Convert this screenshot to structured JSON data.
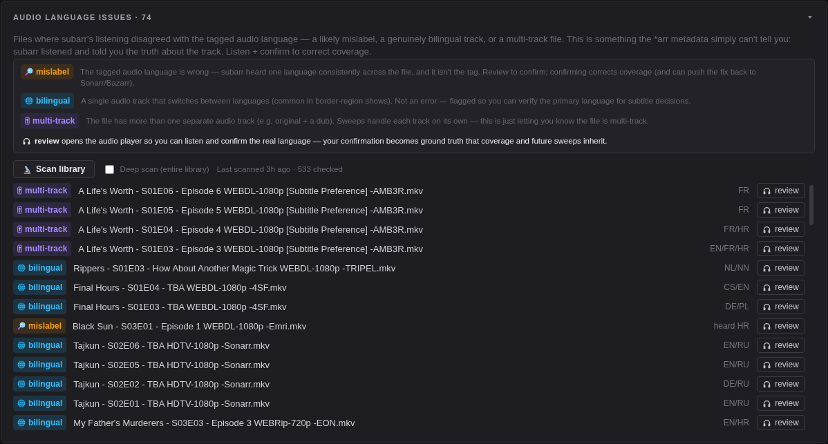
{
  "panel": {
    "title": "AUDIO LANGUAGE ISSUES · 74",
    "description": "Files where subarr's listening disagreed with the tagged audio language — a likely mislabel, a genuinely bilingual track, or a multi-track file. This is something the *arr metadata simply can't tell you: subarr listened and told you the truth about the track. Listen + confirm to correct coverage."
  },
  "legend": {
    "items": [
      {
        "kind": "mislabel",
        "tag": "mislabel",
        "text": "The tagged audio language is wrong — subarr heard one language consistently across the file, and it isn't the tag. Review to confirm; confirming corrects coverage (and can push the fix back to Sonarr/Bazarr)."
      },
      {
        "kind": "bilingual",
        "tag": "bilingual",
        "text": "A single audio track that switches between languages (common in border-region shows). Not an error — flagged so you can verify the primary language for subtitle decisions."
      },
      {
        "kind": "multitrack",
        "tag": "multi-track",
        "text": "The file has more than one separate audio track (e.g. original + a dub). Sweeps handle each track on its own — this is just letting you know the file is multi-track."
      }
    ],
    "note": "**review** opens the audio player so you can listen and confirm the real language — your confirmation becomes ground truth that coverage and future sweeps inherit."
  },
  "toolbar": {
    "scan_button": "Scan library",
    "deep_scan": {
      "label": "Deep scan (entire library)",
      "checked": false
    },
    "status": "Last scanned 3h ago · 533 checked"
  },
  "rows": [
    {
      "kind": "multitrack",
      "tag": "multi-track",
      "file": "A Life's Worth - S01E06 - Episode 6 WEBDL-1080p [Subtitle Preference] -AMB3R.mkv",
      "languages": "FR",
      "action": "review"
    },
    {
      "kind": "multitrack",
      "tag": "multi-track",
      "file": "A Life's Worth - S01E05 - Episode 5 WEBDL-1080p [Subtitle Preference] -AMB3R.mkv",
      "languages": "FR",
      "action": "review"
    },
    {
      "kind": "multitrack",
      "tag": "multi-track",
      "file": "A Life's Worth - S01E04 - Episode 4 WEBDL-1080p [Subtitle Preference] -AMB3R.mkv",
      "languages": "FR/HR",
      "action": "review"
    },
    {
      "kind": "multitrack",
      "tag": "multi-track",
      "file": "A Life's Worth - S01E03 - Episode 3 WEBDL-1080p [Subtitle Preference] -AMB3R.mkv",
      "languages": "EN/FR/HR",
      "action": "review"
    },
    {
      "kind": "bilingual",
      "tag": "bilingual",
      "file": "Rippers - S01E03 - How About Another Magic Trick WEBDL-1080p -TRIPEL.mkv",
      "languages": "NL/NN",
      "action": "review"
    },
    {
      "kind": "bilingual",
      "tag": "bilingual",
      "file": "Final Hours - S01E04 - TBA WEBDL-1080p -4SF.mkv",
      "languages": "CS/EN",
      "action": "review"
    },
    {
      "kind": "bilingual",
      "tag": "bilingual",
      "file": "Final Hours - S01E03 - TBA WEBDL-1080p -4SF.mkv",
      "languages": "DE/PL",
      "action": "review"
    },
    {
      "kind": "mislabel",
      "tag": "mislabel",
      "file": "Black Sun - S03E01 - Episode 1 WEBDL-1080p -Emri.mkv",
      "languages": "heard HR",
      "action": "review"
    },
    {
      "kind": "bilingual",
      "tag": "bilingual",
      "file": "Tajkun - S02E06 - TBA HDTV-1080p -Sonarr.mkv",
      "languages": "EN/RU",
      "action": "review"
    },
    {
      "kind": "bilingual",
      "tag": "bilingual",
      "file": "Tajkun - S02E05 - TBA HDTV-1080p -Sonarr.mkv",
      "languages": "EN/RU",
      "action": "review"
    },
    {
      "kind": "bilingual",
      "tag": "bilingual",
      "file": "Tajkun - S02E02 - TBA HDTV-1080p -Sonarr.mkv",
      "languages": "DE/RU",
      "action": "review"
    },
    {
      "kind": "bilingual",
      "tag": "bilingual",
      "file": "Tajkun - S02E01 - TBA HDTV-1080p -Sonarr.mkv",
      "languages": "EN/RU",
      "action": "review"
    },
    {
      "kind": "bilingual",
      "tag": "bilingual",
      "file": "My Father's Murderers - S03E03 - Episode 3 WEBRip-720p -EON.mkv",
      "languages": "EN/HR",
      "action": "review"
    }
  ]
}
